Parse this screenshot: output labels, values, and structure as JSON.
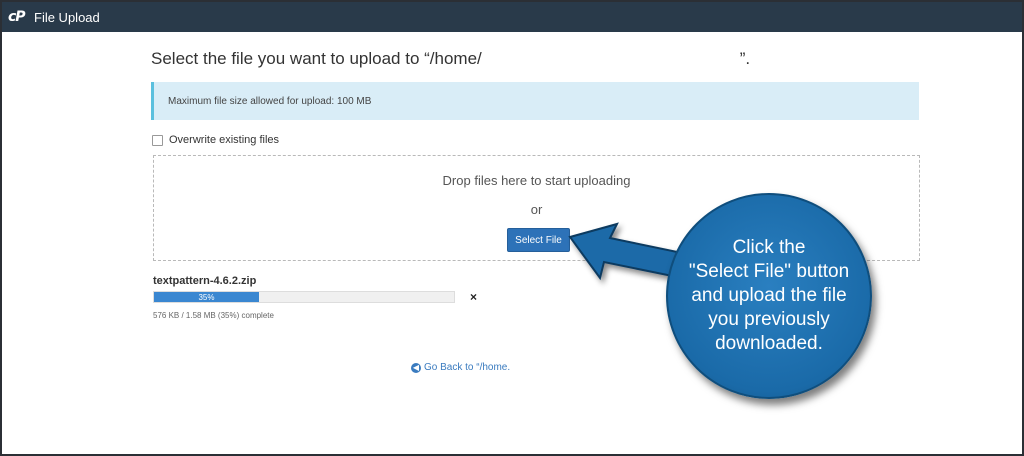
{
  "app": {
    "title": "File Upload",
    "logo_icon": "cpanel-logo-icon"
  },
  "heading": {
    "prefix": "Select the file you want to upload to “/home/",
    "suffix": "”."
  },
  "alert": {
    "text": "Maximum file size allowed for upload: 100 MB"
  },
  "overwrite": {
    "label": "Overwrite existing files",
    "checked": false
  },
  "dropzone": {
    "drop_text": "Drop files here to start uploading",
    "or_text": "or",
    "button_label": "Select File"
  },
  "upload": {
    "filename": "textpattern-4.6.2.zip",
    "progress": 0.35,
    "progress_label": "35%",
    "status": "576 KB / 1.58 MB (35%) complete",
    "cancel_icon": "×"
  },
  "goback": {
    "icon": "arrow-circle-left-icon",
    "label": "Go Back to “/home."
  },
  "callout": {
    "text": "Click the\n\"Select File\" button\nand upload the file\nyou previously\ndownloaded."
  },
  "colors": {
    "topbar": "#293a4a",
    "primary": "#2d72b8",
    "callout": "#1a6aa8",
    "alert_bg": "#d9edf7"
  }
}
